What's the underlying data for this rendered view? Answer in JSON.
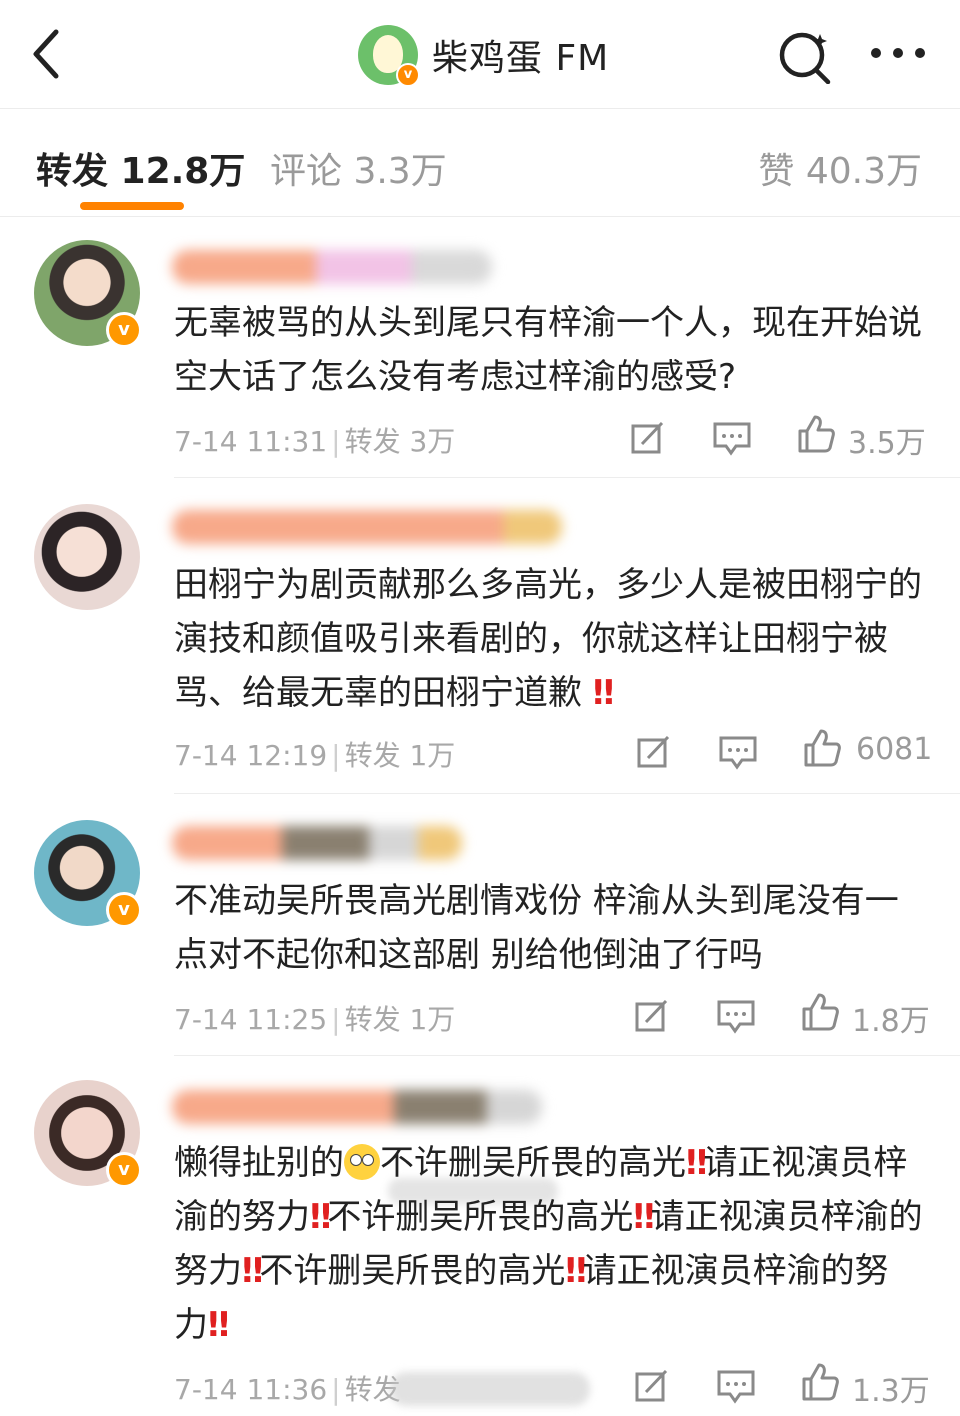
{
  "header": {
    "title": "柴鸡蛋 FM",
    "icons": {
      "back": "back-arrow-icon",
      "search": "search-icon",
      "more": "more-icon"
    }
  },
  "tabs": {
    "reposts": "转发 12.8万",
    "comments": "评论 3.3万",
    "likes": "赞 40.3万"
  },
  "colors": {
    "accent": "#ff8200",
    "badge": "#ff9800",
    "exclamation": "#e02020"
  },
  "reposts": [
    {
      "text": "无辜被骂的从头到尾只有梓渝一个人，现在开始说空大话了怎么没有考虑过梓渝的感受?",
      "time": "7-14 11:31",
      "repost_label": "转发 3万",
      "likes": "3.5万"
    },
    {
      "text": "田栩宁为剧贡献那么多高光，多少人是被田栩宁的演技和颜值吸引来看剧的，你就这样让田栩宁被骂、给最无辜的田栩宁道歉",
      "time": "7-14 12:19",
      "repost_label": "转发 1万",
      "likes": "6081"
    },
    {
      "text": "不准动吴所畏高光剧情戏份 梓渝从头到尾没有一点对不起你和这部剧 别给他倒油了行吗",
      "time": "7-14 11:25",
      "repost_label": "转发 1万",
      "likes": "1.8万"
    },
    {
      "text_parts": [
        "懒得扯别的",
        "不许删吴所畏的高光",
        "请正视演员梓渝的努力",
        "不许删吴所畏的高光",
        "请正视演员梓渝的努力",
        "不许删吴所畏的高光",
        "请正视演员梓渝的努力"
      ],
      "time": "7-14 11:36",
      "repost_label": "转发",
      "likes": "1.3万"
    }
  ],
  "exclaim": "‼"
}
